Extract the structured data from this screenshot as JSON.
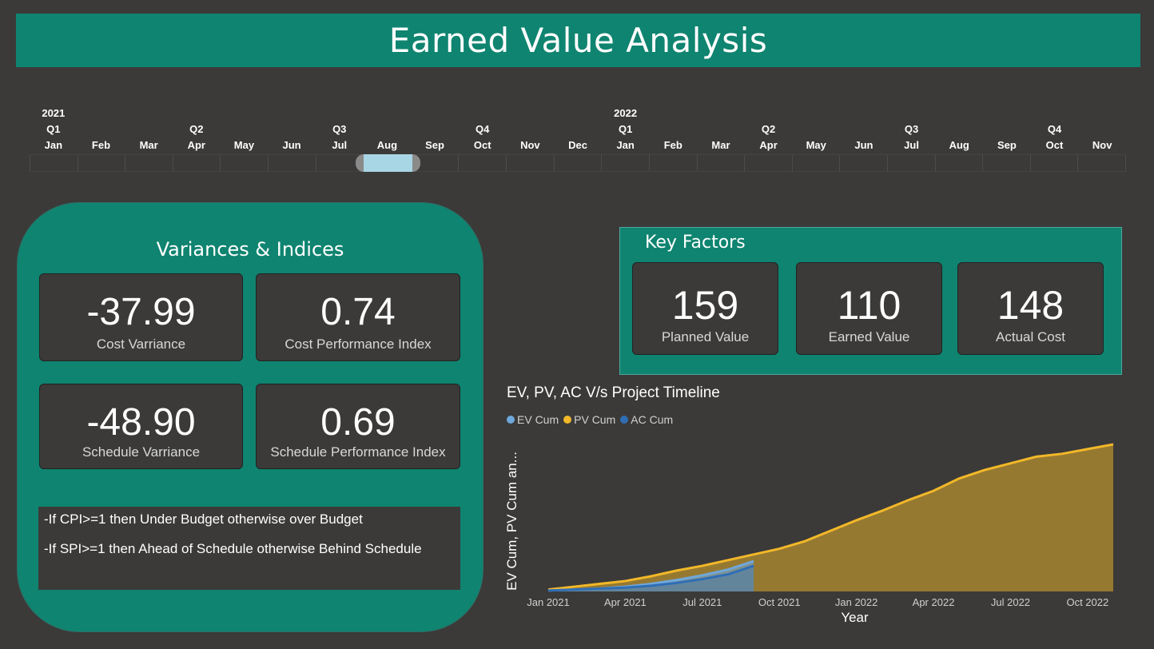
{
  "title": "Earned Value Analysis",
  "timeline": {
    "years": [
      {
        "label": "2021",
        "col": 0
      },
      {
        "label": "2022",
        "col": 12
      }
    ],
    "quarters": [
      {
        "label": "Q1",
        "col": 0
      },
      {
        "label": "Q2",
        "col": 3
      },
      {
        "label": "Q3",
        "col": 6
      },
      {
        "label": "Q4",
        "col": 9
      },
      {
        "label": "Q1",
        "col": 12
      },
      {
        "label": "Q2",
        "col": 15
      },
      {
        "label": "Q3",
        "col": 18
      },
      {
        "label": "Q4",
        "col": 21
      }
    ],
    "months": [
      "Jan",
      "Feb",
      "Mar",
      "Apr",
      "May",
      "Jun",
      "Jul",
      "Aug",
      "Sep",
      "Oct",
      "Nov",
      "Dec",
      "Jan",
      "Feb",
      "Mar",
      "Apr",
      "May",
      "Jun",
      "Jul",
      "Aug",
      "Sep",
      "Oct",
      "Nov"
    ],
    "selected_month": "Aug 2021"
  },
  "variances": {
    "title": "Variances & Indices",
    "cost_variance": {
      "value": "-37.99",
      "label": "Cost Varriance"
    },
    "cpi": {
      "value": "0.74",
      "label": "Cost Performance Index"
    },
    "schedule_variance": {
      "value": "-48.90",
      "label": "Schedule Varriance"
    },
    "spi": {
      "value": "0.69",
      "label": "Schedule Performance Index"
    },
    "notes": [
      "-If CPI>=1 then Under Budget otherwise over Budget",
      "-If SPI>=1 then Ahead of Schedule otherwise Behind Schedule"
    ]
  },
  "key_factors": {
    "title": "Key Factors",
    "planned_value": {
      "value": "159",
      "label": "Planned Value"
    },
    "earned_value": {
      "value": "110",
      "label": "Earned Value"
    },
    "actual_cost": {
      "value": "148",
      "label": "Actual Cost"
    }
  },
  "colors": {
    "accent": "#0f8470",
    "background": "#3b3a39",
    "ev": "#6fa8dc",
    "pv": "#f2b829",
    "ac": "#2f6eb5"
  },
  "chart_data": {
    "type": "area",
    "title": "EV, PV, AC V/s Project Timeline",
    "xlabel": "Year",
    "ylabel": "EV Cum, PV Cum an...",
    "x_ticks": [
      "Jan 2021",
      "Apr 2021",
      "Jul 2021",
      "Oct 2021",
      "Jan 2022",
      "Apr 2022",
      "Jul 2022",
      "Oct 2022"
    ],
    "x_range": [
      "2021-01",
      "2022-11"
    ],
    "ylim": [
      0,
      160
    ],
    "grid": false,
    "legend_position": "top-left",
    "series": [
      {
        "name": "EV Cum",
        "color": "#6fa8dc",
        "x": [
          "2021-01",
          "2021-02",
          "2021-03",
          "2021-04",
          "2021-05",
          "2021-06",
          "2021-07",
          "2021-08",
          "2021-09"
        ],
        "values": [
          1,
          2,
          3,
          5,
          8,
          12,
          17,
          23,
          32
        ]
      },
      {
        "name": "PV Cum",
        "color": "#f2b829",
        "x": [
          "2021-01",
          "2021-02",
          "2021-03",
          "2021-04",
          "2021-05",
          "2021-06",
          "2021-07",
          "2021-08",
          "2021-09",
          "2021-10",
          "2021-11",
          "2021-12",
          "2022-01",
          "2022-02",
          "2022-03",
          "2022-04",
          "2022-05",
          "2022-06",
          "2022-07",
          "2022-08",
          "2022-09",
          "2022-10",
          "2022-11"
        ],
        "values": [
          2,
          5,
          8,
          11,
          16,
          22,
          27,
          33,
          39,
          45,
          53,
          64,
          75,
          85,
          96,
          106,
          119,
          128,
          135,
          142,
          145,
          150,
          155
        ]
      },
      {
        "name": "AC Cum",
        "color": "#2f6eb5",
        "x": [
          "2021-01",
          "2021-02",
          "2021-03",
          "2021-04",
          "2021-05",
          "2021-06",
          "2021-07",
          "2021-08",
          "2021-09"
        ],
        "values": [
          1,
          2,
          3,
          4,
          6,
          9,
          13,
          18,
          27
        ]
      }
    ]
  }
}
